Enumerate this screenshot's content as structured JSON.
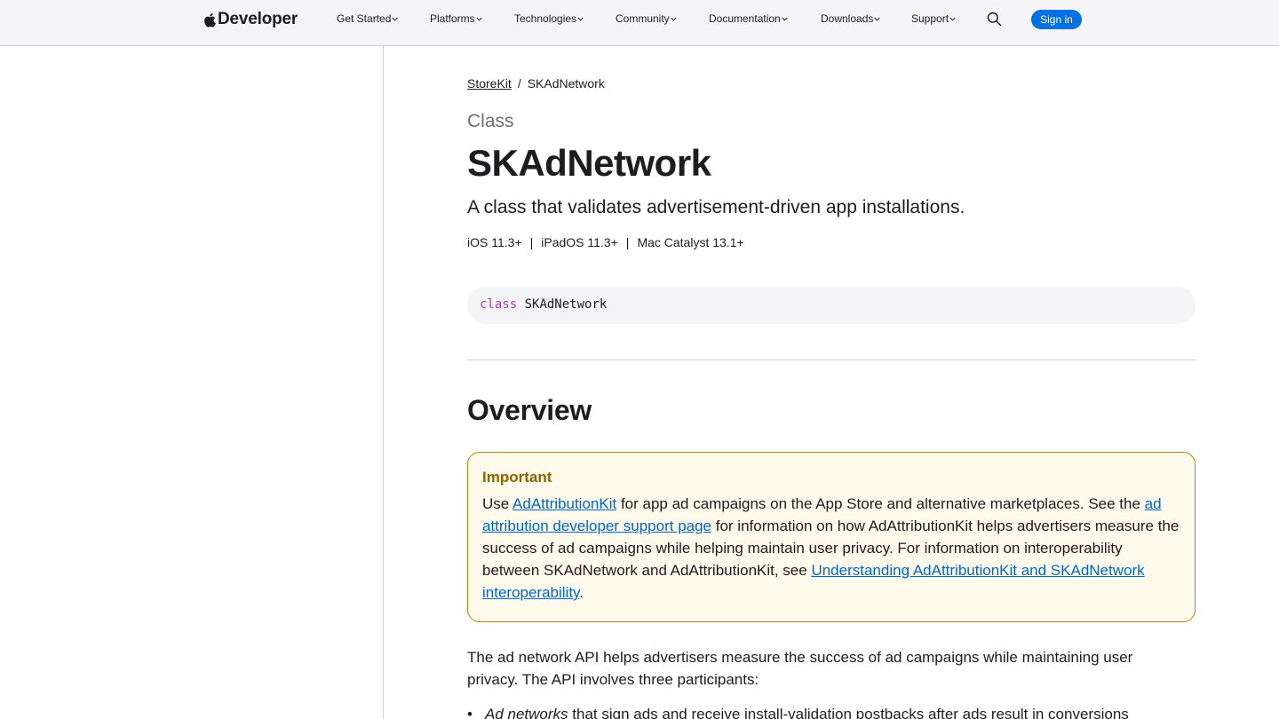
{
  "nav": {
    "brand": "Developer",
    "items": [
      {
        "label": "Get Started"
      },
      {
        "label": "Platforms"
      },
      {
        "label": "Technologies"
      },
      {
        "label": "Community"
      },
      {
        "label": "Documentation"
      },
      {
        "label": "Downloads"
      },
      {
        "label": "Support"
      }
    ],
    "signin": "Sign in"
  },
  "breadcrumb": {
    "parent": "StoreKit",
    "separator": "/",
    "current": "SKAdNetwork"
  },
  "header": {
    "eyebrow": "Class",
    "title": "SKAdNetwork",
    "abstract": "A class that validates advertisement-driven app installations."
  },
  "platforms": [
    {
      "label": "iOS 11.3+"
    },
    {
      "label": "iPadOS 11.3+"
    },
    {
      "label": "Mac Catalyst 13.1+"
    }
  ],
  "platform_separator": "|",
  "declaration": {
    "keyword": "class",
    "name": "SKAdNetwork"
  },
  "overview": {
    "heading": "Overview",
    "important": {
      "label": "Important",
      "t1": "Use ",
      "link1": "AdAttributionKit",
      "t2": " for app ad campaigns on the App Store and alternative marketplaces. See the ",
      "link2": "ad attribution developer support page",
      "t3": " for information on how AdAttributionKit helps advertisers measure the success of ad campaigns while helping maintain user privacy. For information on interoperability between SKAdNetwork and AdAttributionKit, see ",
      "link3": "Understanding AdAttributionKit and SKAdNetwork interoperability",
      "t4": "."
    },
    "paragraph": "The ad network API helps advertisers measure the success of ad campaigns while maintaining user privacy. The API involves three participants:",
    "list": [
      {
        "em": "Ad networks",
        "rest": " that sign ads and receive install-validation postbacks after ads result in conversions"
      }
    ]
  },
  "colors": {
    "accent": "#0071e3",
    "link": "#0066cc",
    "important_border": "#b8860b",
    "important_bg": "#fffaeb",
    "keyword": "#ad3da4"
  },
  "icons": {
    "brand": "apple-logo-icon",
    "search": "search-icon",
    "chevron": "chevron-down-icon"
  }
}
